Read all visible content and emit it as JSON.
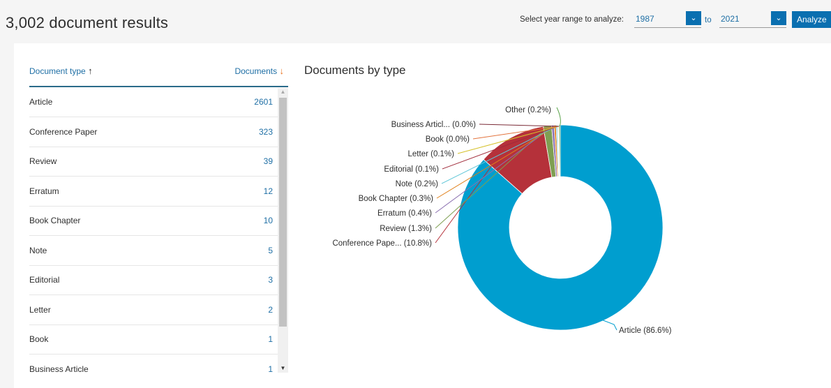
{
  "header": {
    "results_title": "3,002 document results",
    "year_range_label": "Select year range to analyze:",
    "year_from": "1987",
    "to_label": "to",
    "year_to": "2021",
    "analyze_label": "Analyze"
  },
  "table": {
    "col_type": "Document type",
    "col_docs": "Documents",
    "rows": [
      {
        "name": "Article",
        "count": "2601"
      },
      {
        "name": "Conference Paper",
        "count": "323"
      },
      {
        "name": "Review",
        "count": "39"
      },
      {
        "name": "Erratum",
        "count": "12"
      },
      {
        "name": "Book Chapter",
        "count": "10"
      },
      {
        "name": "Note",
        "count": "5"
      },
      {
        "name": "Editorial",
        "count": "3"
      },
      {
        "name": "Letter",
        "count": "2"
      },
      {
        "name": "Book",
        "count": "1"
      },
      {
        "name": "Business Article",
        "count": "1"
      }
    ]
  },
  "chart_data": {
    "type": "pie",
    "donut": true,
    "title": "Documents by type",
    "slices": [
      {
        "label": "Article (86.6%)",
        "name": "Article",
        "value": 86.6,
        "color": "#009ecf"
      },
      {
        "label": "Conference Pape... (10.8%)",
        "name": "Conference Paper",
        "value": 10.8,
        "color": "#b5313a"
      },
      {
        "label": "Review (1.3%)",
        "name": "Review",
        "value": 1.3,
        "color": "#7f9f52"
      },
      {
        "label": "Erratum (0.4%)",
        "name": "Erratum",
        "value": 0.4,
        "color": "#8b70b0"
      },
      {
        "label": "Book Chapter (0.3%)",
        "name": "Book Chapter",
        "value": 0.3,
        "color": "#e1801a"
      },
      {
        "label": "Note (0.2%)",
        "name": "Note",
        "value": 0.2,
        "color": "#61c7d8"
      },
      {
        "label": "Editorial (0.1%)",
        "name": "Editorial",
        "value": 0.1,
        "color": "#a02b3a"
      },
      {
        "label": "Letter (0.1%)",
        "name": "Letter",
        "value": 0.1,
        "color": "#d5c12a"
      },
      {
        "label": "Book (0.0%)",
        "name": "Book",
        "value": 0.03,
        "color": "#e3743e"
      },
      {
        "label": "Business Articl... (0.0%)",
        "name": "Business Article",
        "value": 0.03,
        "color": "#7a2a36"
      },
      {
        "label": "Other (0.2%)",
        "name": "Other",
        "value": 0.2,
        "color": "#5aa34a"
      }
    ]
  }
}
